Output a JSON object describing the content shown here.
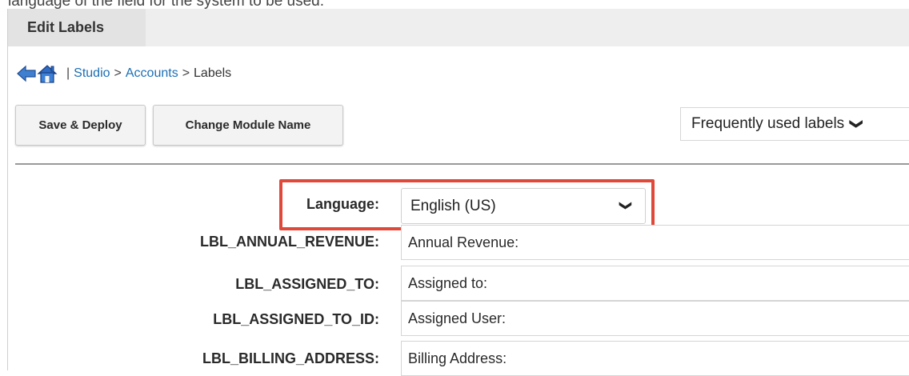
{
  "top_cut_text": "language of the field for the system to be used.",
  "tab": {
    "label": "Edit Labels"
  },
  "breadcrumb": {
    "separator_main": "|",
    "studio": "Studio",
    "gt1": ">",
    "accounts": "Accounts",
    "gt2": ">",
    "current": "Labels",
    "back_icon": "back-arrow-icon",
    "home_icon": "home-icon"
  },
  "toolbar": {
    "save_deploy": "Save & Deploy",
    "change_module_name": "Change Module Name",
    "label_filter": {
      "value": "Frequently used labels",
      "chevron": "❯"
    }
  },
  "language": {
    "label": "Language:",
    "selected": "English (US)",
    "chevron": "❯"
  },
  "labels": [
    {
      "key": "LBL_ANNUAL_REVENUE:",
      "value": "Annual Revenue:"
    },
    {
      "key": "LBL_ASSIGNED_TO:",
      "value": "Assigned to:"
    },
    {
      "key": "LBL_ASSIGNED_TO_ID:",
      "value": "Assigned User:"
    },
    {
      "key": "LBL_BILLING_ADDRESS:",
      "value": "Billing Address:"
    }
  ],
  "colors": {
    "highlight": "#e0483a",
    "link": "#1a6fb5",
    "tab_bg": "#e3e3e3"
  }
}
